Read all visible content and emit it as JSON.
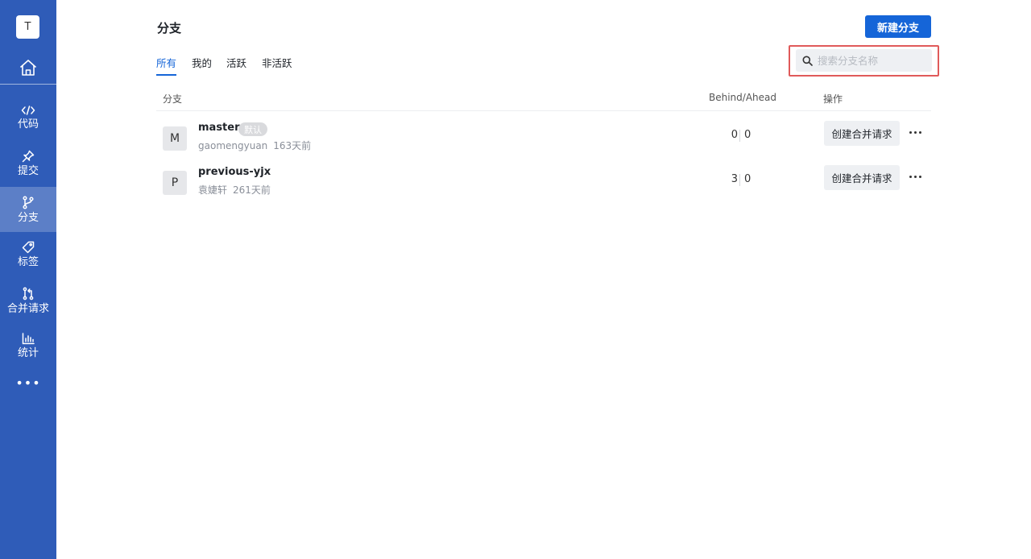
{
  "sidebar": {
    "avatar_letter": "T",
    "home_icon": "home-icon",
    "items": [
      {
        "label": "代码",
        "icon": "code-icon"
      },
      {
        "label": "提交",
        "icon": "pin-icon"
      },
      {
        "label": "分支",
        "icon": "branch-icon",
        "active": true
      },
      {
        "label": "标签",
        "icon": "tag-icon"
      },
      {
        "label": "合并请求",
        "icon": "merge-request-icon"
      },
      {
        "label": "统计",
        "icon": "bar-chart-icon"
      }
    ],
    "more_label": "•••"
  },
  "header": {
    "title": "分支",
    "new_branch_label": "新建分支"
  },
  "tabs": [
    {
      "label": "所有",
      "active": true
    },
    {
      "label": "我的"
    },
    {
      "label": "活跃"
    },
    {
      "label": "非活跃"
    }
  ],
  "search": {
    "placeholder": "搜索分支名称",
    "value": ""
  },
  "table": {
    "columns": {
      "branch": "分支",
      "behind_ahead": "Behind/Ahead",
      "actions": "操作"
    },
    "rows": [
      {
        "avatar_letter": "M",
        "name": "master",
        "badge": "默认",
        "author": "gaomengyuan",
        "time": "163天前",
        "behind": "0",
        "ahead": "0",
        "action_label": "创建合并请求"
      },
      {
        "avatar_letter": "P",
        "name": "previous-yjx",
        "author": "袁婕轩",
        "time": "261天前",
        "behind": "3",
        "ahead": "0",
        "action_label": "创建合并请求"
      }
    ]
  },
  "colors": {
    "sidebar_bg": "#2f5cb8",
    "primary": "#1565d8",
    "highlight_border": "#e05a5a"
  }
}
